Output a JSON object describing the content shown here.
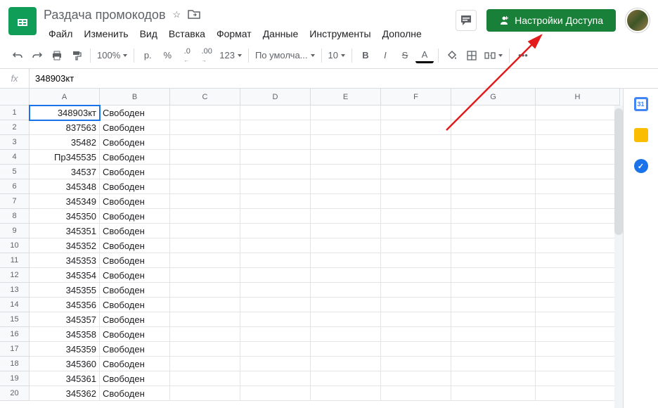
{
  "doc": {
    "title": "Раздача промокодов"
  },
  "menus": {
    "file": "Файл",
    "edit": "Изменить",
    "view": "Вид",
    "insert": "Вставка",
    "format": "Формат",
    "data": "Данные",
    "tools": "Инструменты",
    "addons": "Дополне"
  },
  "share": {
    "label": "Настройки Доступа"
  },
  "toolbar": {
    "zoom": "100%",
    "currency": "р.",
    "percent": "%",
    "dec_dec": ".0",
    "dec_inc": ".00",
    "more_formats": "123",
    "font": "По умолча...",
    "size": "10"
  },
  "formula": {
    "fx": "fx",
    "value": "348903кт"
  },
  "columns": [
    "A",
    "B",
    "C",
    "D",
    "E",
    "F",
    "G",
    "H"
  ],
  "rows": [
    {
      "n": "1",
      "a": "348903кт",
      "b": "Свободен"
    },
    {
      "n": "2",
      "a": "837563",
      "b": "Свободен"
    },
    {
      "n": "3",
      "a": "35482",
      "b": "Свободен"
    },
    {
      "n": "4",
      "a": "Пр345535",
      "b": "Свободен"
    },
    {
      "n": "5",
      "a": "34537",
      "b": "Свободен"
    },
    {
      "n": "6",
      "a": "345348",
      "b": "Свободен"
    },
    {
      "n": "7",
      "a": "345349",
      "b": "Свободен"
    },
    {
      "n": "8",
      "a": "345350",
      "b": "Свободен"
    },
    {
      "n": "9",
      "a": "345351",
      "b": "Свободен"
    },
    {
      "n": "10",
      "a": "345352",
      "b": "Свободен"
    },
    {
      "n": "11",
      "a": "345353",
      "b": "Свободен"
    },
    {
      "n": "12",
      "a": "345354",
      "b": "Свободен"
    },
    {
      "n": "13",
      "a": "345355",
      "b": "Свободен"
    },
    {
      "n": "14",
      "a": "345356",
      "b": "Свободен"
    },
    {
      "n": "15",
      "a": "345357",
      "b": "Свободен"
    },
    {
      "n": "16",
      "a": "345358",
      "b": "Свободен"
    },
    {
      "n": "17",
      "a": "345359",
      "b": "Свободен"
    },
    {
      "n": "18",
      "a": "345360",
      "b": "Свободен"
    },
    {
      "n": "19",
      "a": "345361",
      "b": "Свободен"
    },
    {
      "n": "20",
      "a": "345362",
      "b": "Свободен"
    }
  ],
  "side_calendar_day": "31"
}
